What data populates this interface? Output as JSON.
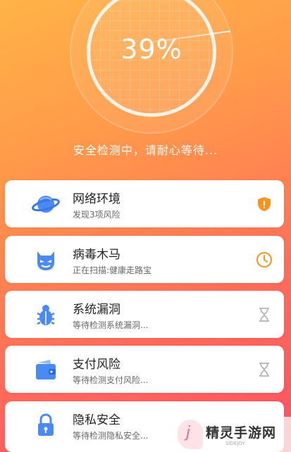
{
  "scan": {
    "percent": "39%",
    "status": "安全检测中，请耐心等待..."
  },
  "cards": [
    {
      "title": "网络环境",
      "subtitle": "发现3项风险",
      "icon": "planet-icon",
      "state": "warning-shield-icon"
    },
    {
      "title": "病毒木马",
      "subtitle": "正在扫描:健康走路宝",
      "icon": "devil-icon",
      "state": "clock-icon"
    },
    {
      "title": "系统漏洞",
      "subtitle": "等待检测系统漏洞...",
      "icon": "bug-icon",
      "state": "hourglass-icon"
    },
    {
      "title": "支付风险",
      "subtitle": "等待检测支付风险...",
      "icon": "wallet-icon",
      "state": "hourglass-icon"
    },
    {
      "title": "隐私安全",
      "subtitle": "等待检测隐私安全...",
      "icon": "lock-icon",
      "state": "hourglass-icon"
    }
  ],
  "watermark": {
    "text": "精灵手游网",
    "small": "SIDEJOY",
    "logo_letter": "j"
  },
  "colors": {
    "accent_blue": "#4a8af4",
    "warning_orange": "#f7931e",
    "gray_icon": "#b5b5b5"
  }
}
